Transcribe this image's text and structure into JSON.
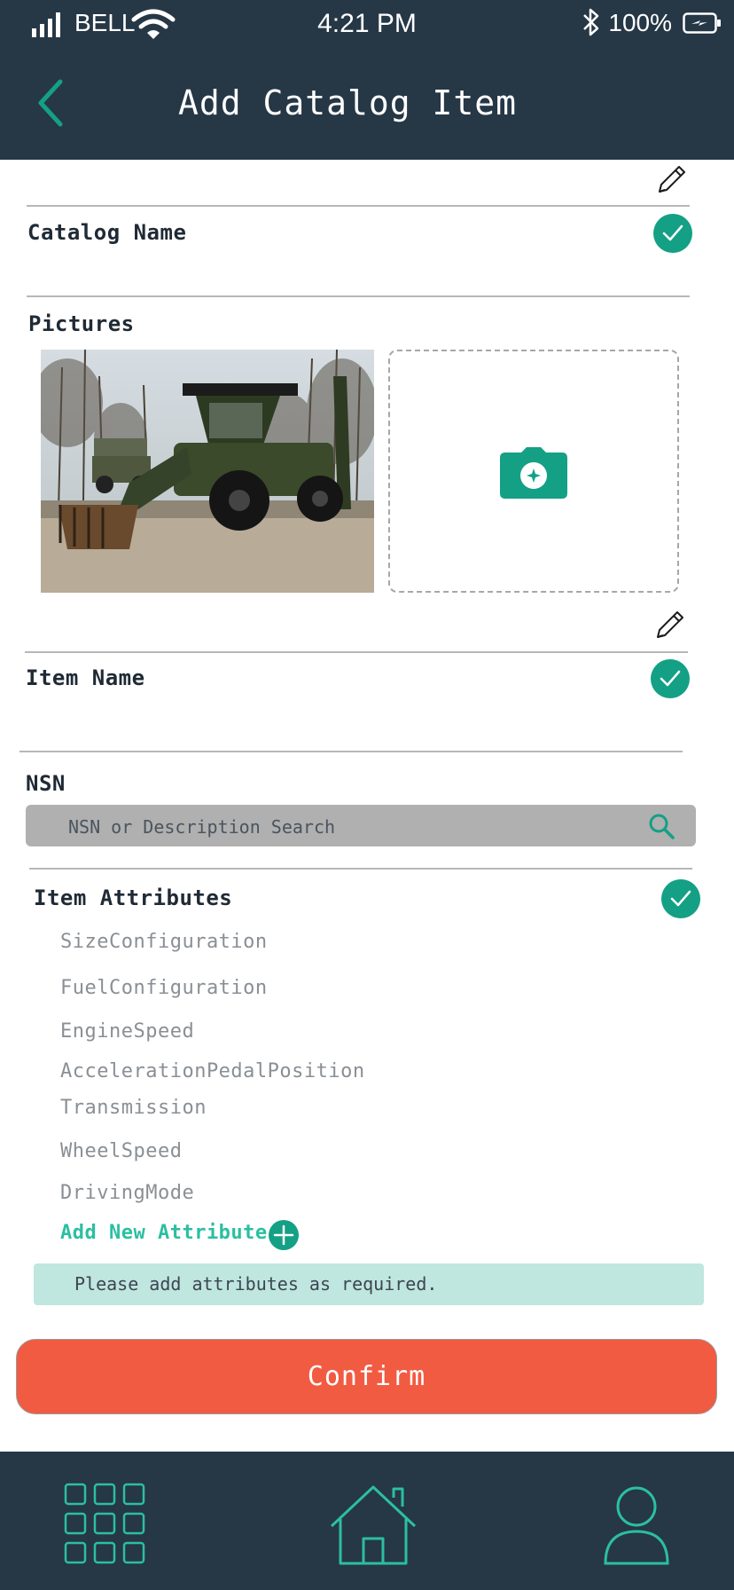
{
  "status_bar": {
    "carrier": "BELL",
    "time": "4:21 PM",
    "battery": "100%"
  },
  "header": {
    "title": "Add Catalog Item",
    "back_icon": "chevron-left-icon"
  },
  "form": {
    "catalog_name_label": "Catalog Name",
    "pictures_label": "Pictures",
    "item_name_label": "Item Name",
    "nsn_label": "NSN",
    "nsn_placeholder": "NSN or Description Search",
    "attributes_label": "Item Attributes",
    "attributes": [
      "SizeConfiguration",
      "FuelConfiguration",
      "EngineSpeed",
      "AccelerationPedalPosition",
      "Transmission",
      "WheelSpeed",
      "DrivingMode"
    ],
    "add_attribute_label": "Add New Attribute",
    "note": "Please add attributes as required."
  },
  "confirm_label": "Confirm",
  "tab_bar": {
    "tabs": [
      "grid-icon",
      "home-icon",
      "user-icon"
    ]
  },
  "colors": {
    "header_bg": "#263746",
    "accent": "#14a085",
    "confirm": "#f15b42",
    "note_bg": "#bfe6df"
  }
}
